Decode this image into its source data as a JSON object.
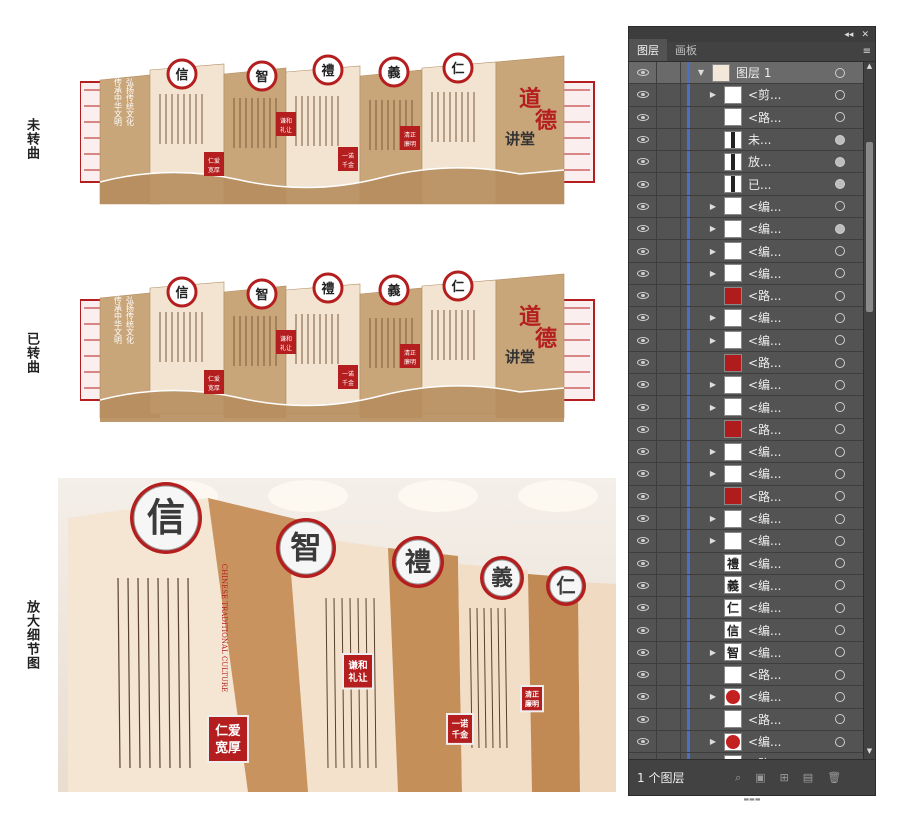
{
  "labels": {
    "unbent": "未转曲",
    "bent": "已转曲",
    "detail": "放大细节图"
  },
  "wall": {
    "medallions": [
      "信",
      "智",
      "禮",
      "義",
      "仁"
    ],
    "slogan_line1": "弘扬传统文化",
    "slogan_line2": "传承中华文明",
    "badges": [
      "仁爱宽厚",
      "谦和礼让",
      "一诺千金",
      "清正廉明"
    ],
    "title_char1": "道",
    "title_char2": "德",
    "title_rest": "讲堂"
  },
  "photo": {
    "medallions": [
      "信",
      "智",
      "禮",
      "義",
      "仁"
    ],
    "badges": [
      "仁爱宽厚",
      "谦和礼让",
      "一诺千金",
      "清正廉明"
    ],
    "english": "CHINESE TRADITIONAL CULTURE",
    "caption": "仁爱宽厚"
  },
  "panel": {
    "tabs": [
      "图层",
      "画板"
    ],
    "top_controls": [
      "◂◂",
      "✕"
    ],
    "menu_icon": "≡",
    "footer_count": "1 个图层",
    "layers": [
      {
        "name": "图层 1",
        "expander": "▼",
        "thumb": "top1",
        "target": "hollow"
      },
      {
        "name": "<剪...",
        "expander": "▶",
        "thumb": "plain",
        "target": "hollow"
      },
      {
        "name": "<路...",
        "expander": "",
        "thumb": "plain",
        "target": "hollow"
      },
      {
        "name": "未...",
        "expander": "",
        "thumb": "dark",
        "target": "filled"
      },
      {
        "name": "放...",
        "expander": "",
        "thumb": "dark",
        "target": "filled"
      },
      {
        "name": "已...",
        "expander": "",
        "thumb": "dark",
        "target": "filled"
      },
      {
        "name": "<编...",
        "expander": "▶",
        "thumb": "plain",
        "target": "hollow"
      },
      {
        "name": "<编...",
        "expander": "▶",
        "thumb": "plain",
        "target": "filled"
      },
      {
        "name": "<编...",
        "expander": "▶",
        "thumb": "plain",
        "target": "hollow"
      },
      {
        "name": "<编...",
        "expander": "▶",
        "thumb": "plain",
        "target": "hollow"
      },
      {
        "name": "<路...",
        "expander": "",
        "thumb": "red",
        "target": "hollow"
      },
      {
        "name": "<编...",
        "expander": "▶",
        "thumb": "plain",
        "target": "hollow"
      },
      {
        "name": "<编...",
        "expander": "▶",
        "thumb": "plain",
        "target": "hollow"
      },
      {
        "name": "<路...",
        "expander": "",
        "thumb": "red",
        "target": "hollow"
      },
      {
        "name": "<编...",
        "expander": "▶",
        "thumb": "plain",
        "target": "hollow"
      },
      {
        "name": "<编...",
        "expander": "▶",
        "thumb": "plain",
        "target": "hollow"
      },
      {
        "name": "<路...",
        "expander": "",
        "thumb": "red",
        "target": "hollow"
      },
      {
        "name": "<编...",
        "expander": "▶",
        "thumb": "plain",
        "target": "hollow"
      },
      {
        "name": "<编...",
        "expander": "▶",
        "thumb": "plain",
        "target": "hollow"
      },
      {
        "name": "<路...",
        "expander": "",
        "thumb": "red",
        "target": "hollow"
      },
      {
        "name": "<编...",
        "expander": "▶",
        "thumb": "plain",
        "target": "hollow"
      },
      {
        "name": "<编...",
        "expander": "▶",
        "thumb": "plain",
        "target": "hollow"
      },
      {
        "name": "<编...",
        "expander": "",
        "thumb": "禮",
        "target": "hollow"
      },
      {
        "name": "<编...",
        "expander": "",
        "thumb": "義",
        "target": "hollow"
      },
      {
        "name": "<编...",
        "expander": "",
        "thumb": "仁",
        "target": "hollow"
      },
      {
        "name": "<编...",
        "expander": "",
        "thumb": "信",
        "target": "hollow"
      },
      {
        "name": "<编...",
        "expander": "▶",
        "thumb": "智",
        "target": "hollow"
      },
      {
        "name": "<路...",
        "expander": "",
        "thumb": "plain",
        "target": "hollow"
      },
      {
        "name": "<编...",
        "expander": "▶",
        "thumb": "redcircle",
        "target": "hollow"
      },
      {
        "name": "<路...",
        "expander": "",
        "thumb": "plain",
        "target": "hollow"
      },
      {
        "name": "<编...",
        "expander": "▶",
        "thumb": "redcircle",
        "target": "hollow"
      },
      {
        "name": "<路...",
        "expander": "",
        "thumb": "plain",
        "target": "hollow"
      }
    ]
  },
  "colors": {
    "panel_bg": "#535353",
    "accent_red": "#b41e1e",
    "wall_tan": "#c9a67a",
    "wall_cream": "#f3e4d2",
    "selection_bar": "#4a6fc4"
  }
}
